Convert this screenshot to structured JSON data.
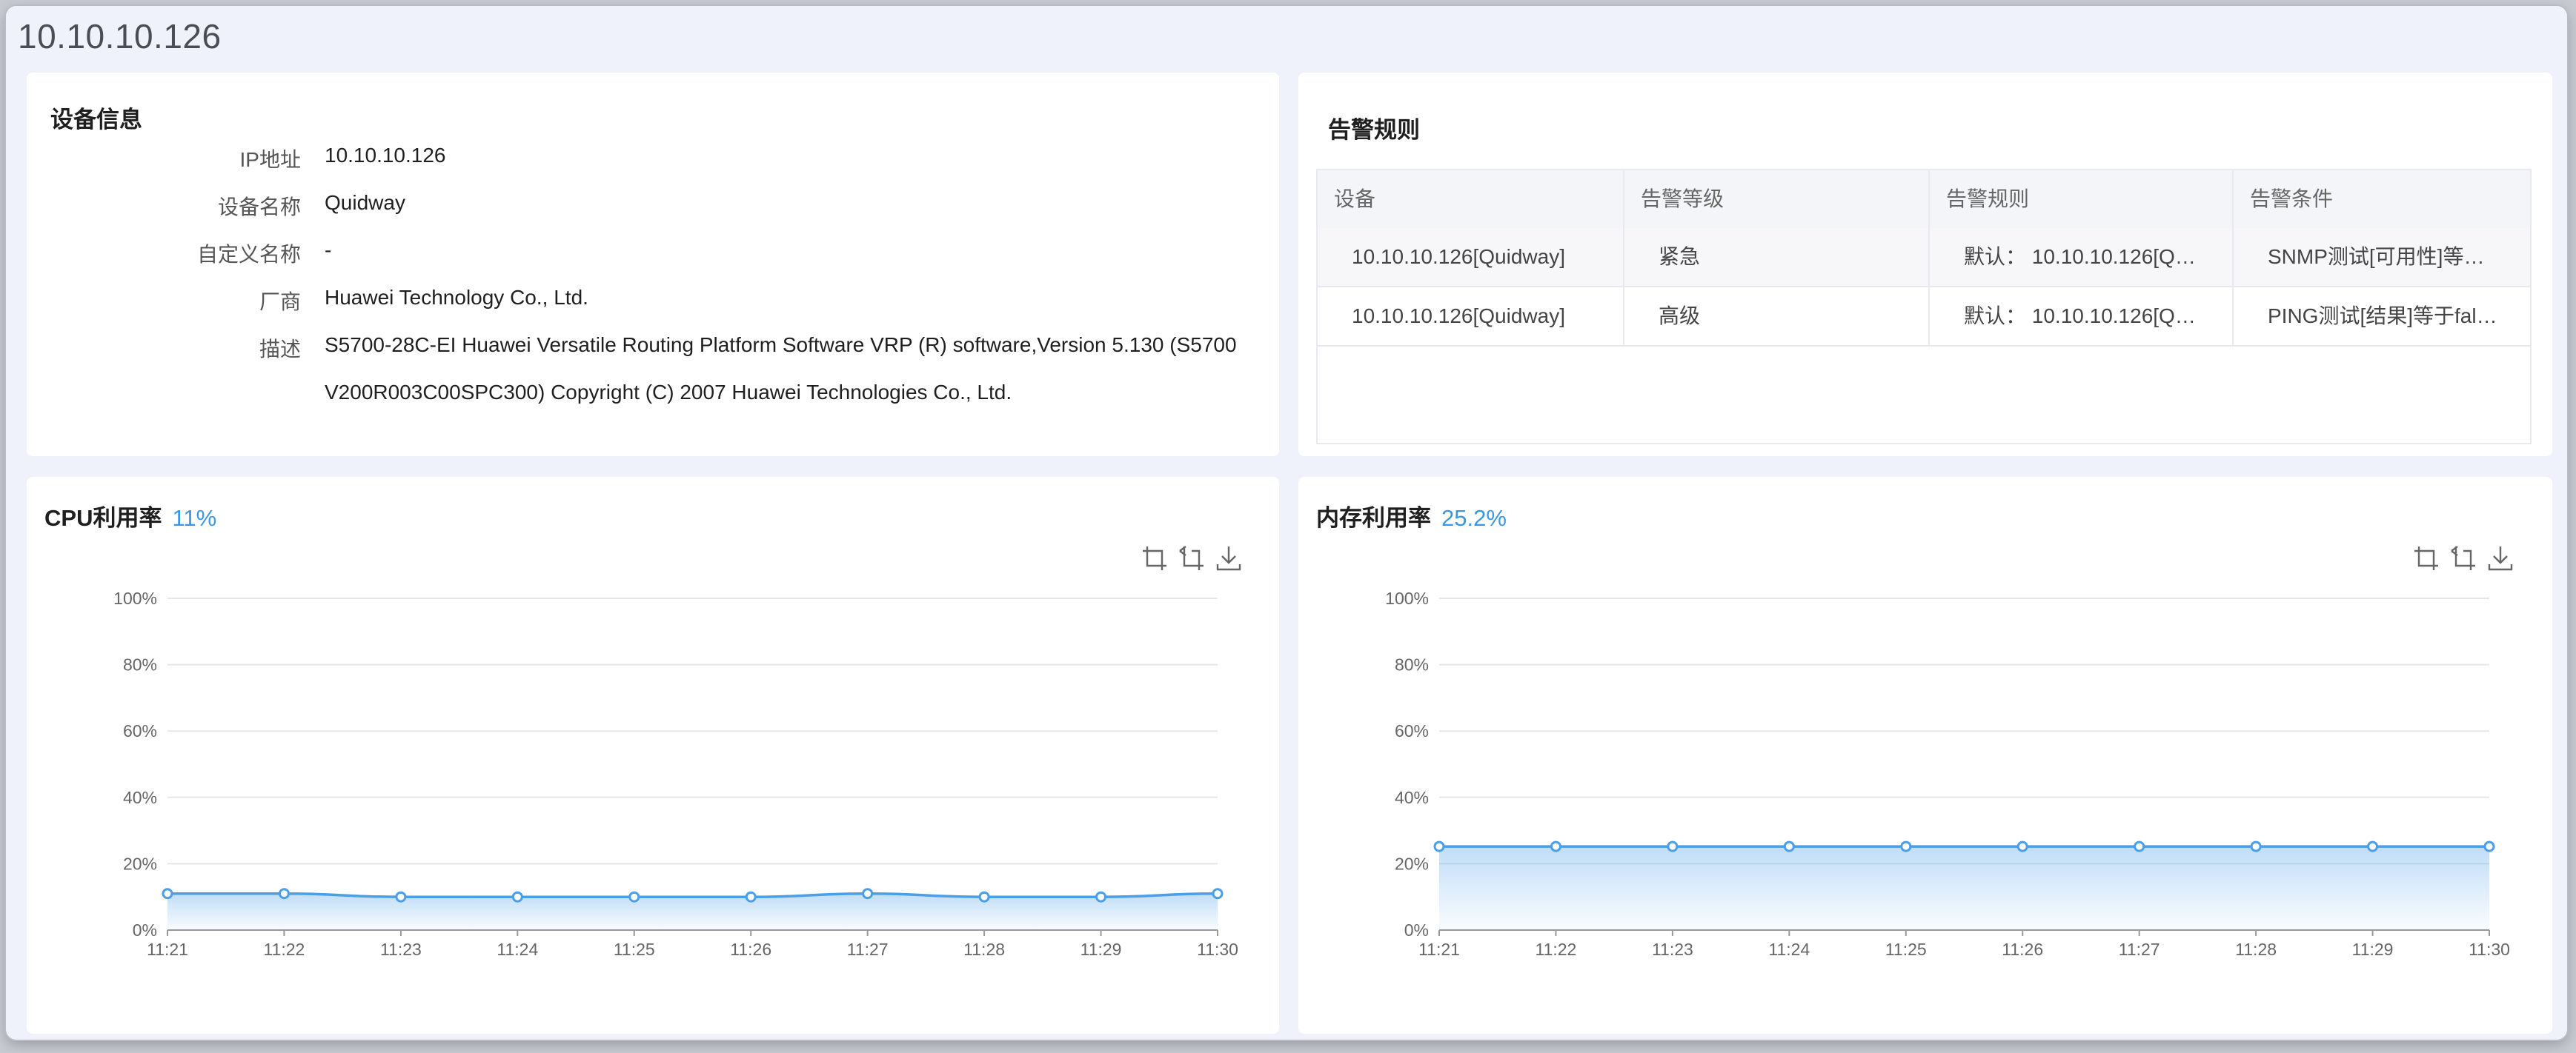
{
  "page": {
    "title": "10.10.10.126"
  },
  "device_info": {
    "title": "设备信息",
    "rows": [
      {
        "label": "IP地址",
        "value": "10.10.10.126"
      },
      {
        "label": "设备名称",
        "value": "Quidway"
      },
      {
        "label": "自定义名称",
        "value": "-"
      },
      {
        "label": "厂商",
        "value": "Huawei Technology Co., Ltd."
      },
      {
        "label": "描述",
        "value": "S5700-28C-EI Huawei Versatile Routing Platform Software VRP (R) software,Version 5.130 (S5700 V200R003C00SPC300) Copyright (C) 2007 Huawei Technologies Co., Ltd."
      }
    ]
  },
  "alarm_rules": {
    "title": "告警规则",
    "columns": [
      "设备",
      "告警等级",
      "告警规则",
      "告警条件"
    ],
    "rows": [
      [
        "10.10.10.126[Quidway]",
        "紧急",
        "默认： 10.10.10.126[Q…",
        "SNMP测试[可用性]等…"
      ],
      [
        "10.10.10.126[Quidway]",
        "高级",
        "默认： 10.10.10.126[Q…",
        "PING测试[结果]等于fal…"
      ]
    ]
  },
  "cpu": {
    "title": "CPU利用率",
    "current": "11%",
    "tools": [
      "zoom-select-icon",
      "zoom-reset-icon",
      "download-icon"
    ]
  },
  "memory": {
    "title": "内存利用率",
    "current": "25.2%",
    "tools": [
      "zoom-select-icon",
      "zoom-reset-icon",
      "download-icon"
    ]
  },
  "colors": {
    "accent": "#3a97e8",
    "line": "#4b9ee8",
    "grid": "#e6e6e6"
  },
  "chart_data": [
    {
      "type": "area",
      "title": "CPU利用率",
      "categories": [
        "11:21",
        "11:22",
        "11:23",
        "11:24",
        "11:25",
        "11:26",
        "11:27",
        "11:28",
        "11:29",
        "11:30"
      ],
      "series": [
        {
          "values": [
            11,
            11,
            10,
            10,
            10,
            10,
            11,
            10,
            10,
            11
          ]
        }
      ],
      "ylim": [
        0,
        100
      ],
      "yticks": [
        "0%",
        "20%",
        "40%",
        "60%",
        "80%",
        "100%"
      ],
      "grid": true
    },
    {
      "type": "area",
      "title": "内存利用率",
      "categories": [
        "11:21",
        "11:22",
        "11:23",
        "11:24",
        "11:25",
        "11:26",
        "11:27",
        "11:28",
        "11:29",
        "11:30"
      ],
      "series": [
        {
          "values": [
            25.2,
            25.2,
            25.2,
            25.2,
            25.2,
            25.2,
            25.2,
            25.2,
            25.2,
            25.2
          ]
        }
      ],
      "ylim": [
        0,
        100
      ],
      "yticks": [
        "0%",
        "20%",
        "40%",
        "60%",
        "80%",
        "100%"
      ],
      "grid": true
    }
  ]
}
